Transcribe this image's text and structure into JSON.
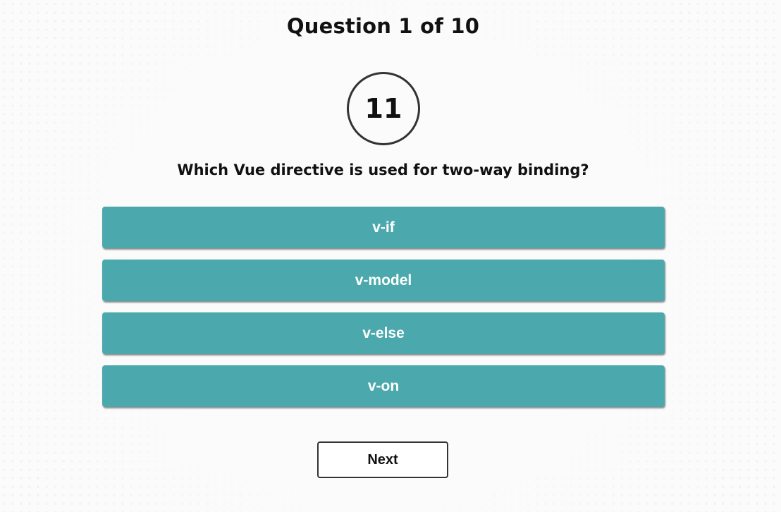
{
  "header": {
    "title": "Question 1 of 10"
  },
  "timer": {
    "value": "11"
  },
  "question": {
    "text": "Which Vue directive is used for two-way binding?"
  },
  "options": [
    {
      "label": "v-if"
    },
    {
      "label": "v-model"
    },
    {
      "label": "v-else"
    },
    {
      "label": "v-on"
    }
  ],
  "footer": {
    "next_label": "Next"
  },
  "colors": {
    "option_bg": "#4ba9ad",
    "text": "#111111",
    "page_bg": "#fbfbfb"
  }
}
